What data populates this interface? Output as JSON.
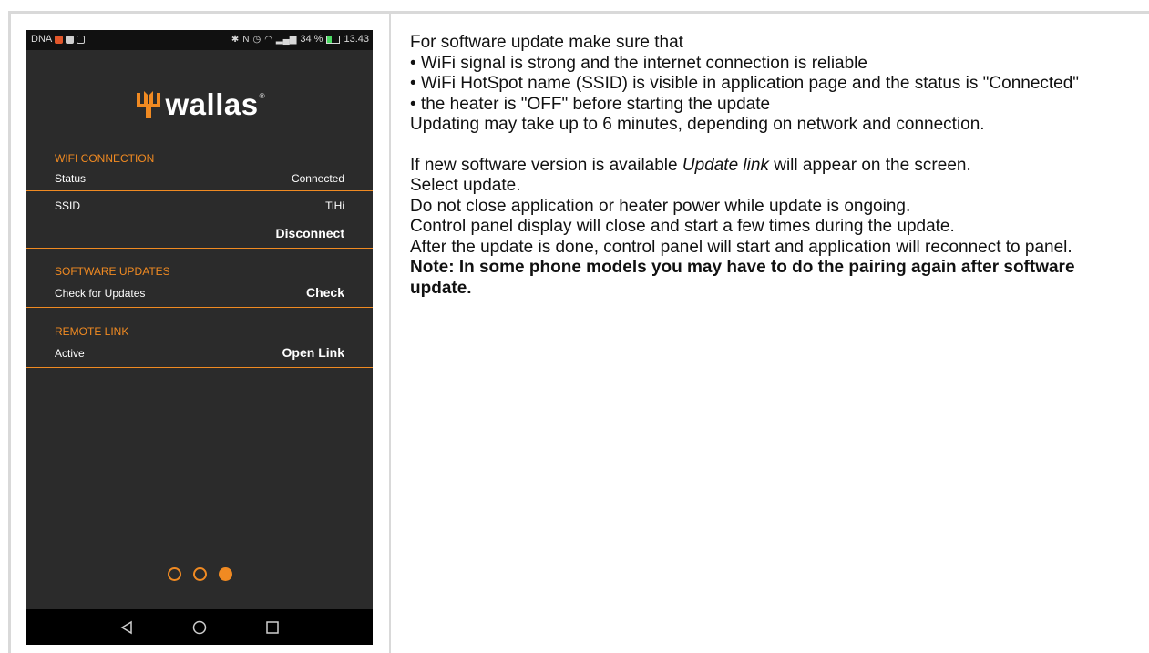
{
  "phone": {
    "status_bar": {
      "carrier": "DNA",
      "left_icons": [
        "notification-icon",
        "notification-icon",
        "notification-icon"
      ],
      "right_icons": [
        "bluetooth-icon",
        "nfc-icon",
        "alarm-icon",
        "wifi-icon",
        "signal-icon"
      ],
      "battery_text": "34 %",
      "battery_level_percent": 34,
      "time": "13.43"
    },
    "logo": {
      "text": "wallas",
      "reg": "®",
      "brand_color": "#f08a22"
    },
    "wifi_connection": {
      "header": "WIFI CONNECTION",
      "status_label": "Status",
      "status_value": "Connected",
      "ssid_label": "SSID",
      "ssid_value": "TiHi",
      "disconnect_label": "Disconnect"
    },
    "software_updates": {
      "header": "SOFTWARE UPDATES",
      "check_label": "Check for Updates",
      "check_button": "Check"
    },
    "remote_link": {
      "header": "REMOTE LINK",
      "active_label": "Active",
      "open_button": "Open Link"
    },
    "pager": {
      "count": 3,
      "active_index": 2
    },
    "nav": {
      "icons": [
        "back-icon",
        "home-icon",
        "recents-icon"
      ]
    },
    "colors": {
      "accent": "#f08a22",
      "background": "#2b2b2b",
      "status_bar": "#111111",
      "nav_bar": "#000000"
    }
  },
  "instructions": {
    "intro": "For software update make sure that",
    "bullets": [
      "• WiFi signal is strong and the internet connection is reliable",
      "• WiFi HotSpot name (SSID) is visible in application page and the status is \"Connected\"",
      "• the heater is \"OFF\" before starting the update"
    ],
    "duration": "Updating may take up to 6 minutes, depending on network and connection.",
    "link_text_before": "If new software version is available ",
    "link_text_italic": "Update link",
    "link_text_after": " will appear on the screen.",
    "select": "Select update.",
    "warning1": "Do not close application or heater power while update is ongoing.",
    "warning2": "Control panel display will close and start a few times during the update.",
    "after": "After the update is done, control panel will start and application will reconnect to panel.",
    "note": "Note: In some phone models you may have to do the pairing again after software update."
  }
}
